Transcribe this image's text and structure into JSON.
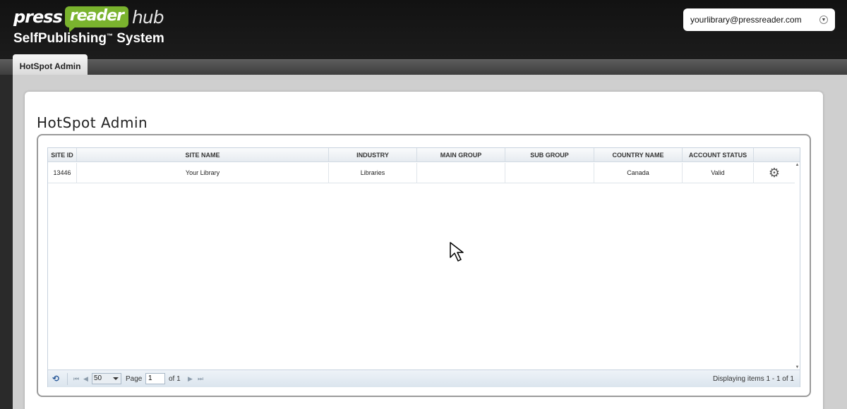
{
  "header": {
    "logo": {
      "press": "press",
      "reader": "reader",
      "hub": "hub"
    },
    "app_title": "SelfPublishing",
    "app_title_tm": "™",
    "app_title_suffix": " System",
    "account": {
      "value": "yourlibrary@pressreader.com"
    }
  },
  "tabs": [
    {
      "label": "HotSpot Admin",
      "active": true
    }
  ],
  "page": {
    "title": "HotSpot Admin"
  },
  "grid": {
    "columns": [
      "SITE ID",
      "SITE NAME",
      "INDUSTRY",
      "MAIN GROUP",
      "SUB GROUP",
      "COUNTRY NAME",
      "ACCOUNT STATUS"
    ],
    "rows": [
      {
        "site_id": "13446",
        "site_name": "Your Library",
        "industry": "Libraries",
        "main_group": "",
        "sub_group": "",
        "country": "Canada",
        "status": "Valid"
      }
    ],
    "pager": {
      "page_size": "50",
      "page_label": "Page",
      "page_value": "1",
      "of_label": "of 1",
      "display_text": "Displaying items 1 - 1 of 1"
    }
  },
  "colors": {
    "brand_green": "#7ab32e",
    "topbar": "#151515"
  },
  "icons": [
    "chevron-down-icon",
    "gear-icon",
    "refresh-icon",
    "first-page-icon",
    "prev-page-icon",
    "next-page-icon",
    "last-page-icon",
    "mouse-cursor-icon"
  ]
}
